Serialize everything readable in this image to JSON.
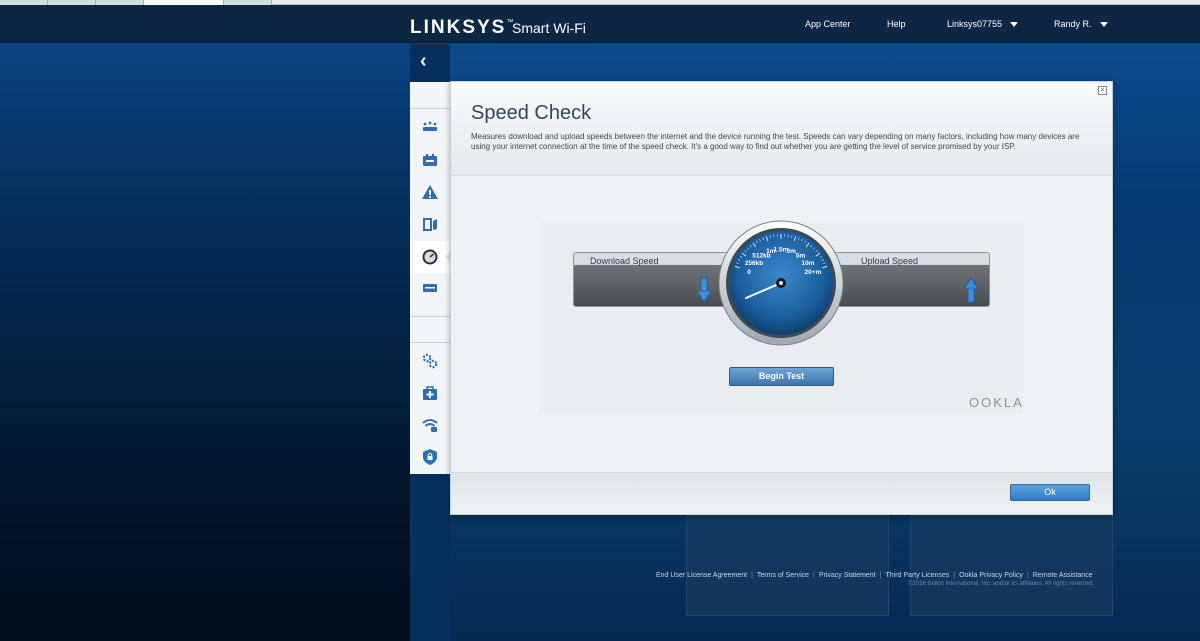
{
  "header": {
    "brand": "LINKSYS",
    "brand_mark": "™",
    "product": "Smart Wi-Fi",
    "nav": {
      "app_center": "App Center",
      "help": "Help",
      "router_name": "Linksys07755",
      "user_name": "Randy R."
    }
  },
  "sidebar": {
    "items": [
      {
        "icon": "network-map-icon"
      },
      {
        "icon": "router-settings-icon"
      },
      {
        "icon": "troubleshooting-icon"
      },
      {
        "icon": "external-storage-icon"
      },
      {
        "icon": "speed-check-icon",
        "active": true
      },
      {
        "icon": "media-prioritization-icon"
      },
      {
        "icon": "connectivity-icon"
      },
      {
        "icon": "troubleshooting-kit-icon"
      },
      {
        "icon": "wireless-icon"
      },
      {
        "icon": "security-icon"
      }
    ]
  },
  "modal": {
    "title": "Speed Check",
    "description": "Measures download and upload speeds between the internet and the device running the test. Speeds can vary depending on many factors, including how many devices are using your internet connection at the time of the speed check. It's a good way to find out whether you are getting the level of service promised by your ISP.",
    "download_label": "Download Speed",
    "upload_label": "Upload Speed",
    "gauge_ticks": [
      "0",
      "256kb",
      "512kb",
      "1m",
      "1.5m",
      "3m",
      "5m",
      "10m",
      "20+m"
    ],
    "begin_button": "Begin Test",
    "ookla_logo": "OOKLA",
    "ok_button": "Ok"
  },
  "footer": {
    "links": [
      "End User License Agreement",
      "Terms of Service",
      "Privacy Statement",
      "Third Party Licenses",
      "Ookla Privacy Policy",
      "Remote Assistance"
    ],
    "copyright": "©2016 Belkin International, Inc. and/or its affiliates. All rights reserved."
  },
  "colors": {
    "header_bg": "#0d2643",
    "page_blue": "#0a4a8d",
    "button_blue": "#3b75b0",
    "gauge_blue": "#1f6fb8"
  }
}
